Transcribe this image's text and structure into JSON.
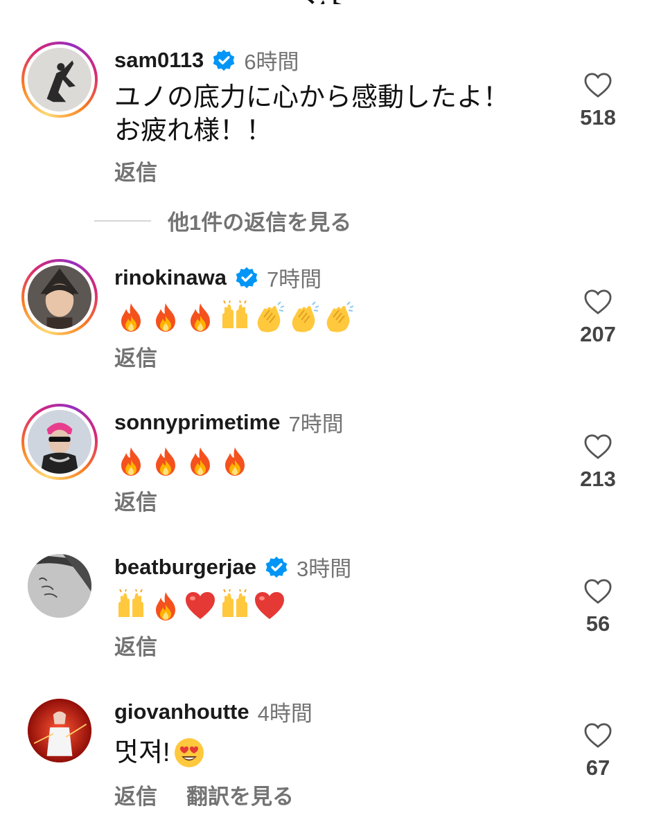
{
  "header": {
    "title_cut": "ント"
  },
  "comments": [
    {
      "username": "sam0113",
      "verified": true,
      "time": "6時間",
      "text_lines": [
        "ユノの底力に心から感動したよ！",
        "お疲れ様！！"
      ],
      "reply_label": "返信",
      "likes": "518",
      "ring": true
    },
    {
      "username": "rinokinawa",
      "verified": true,
      "time": "7時間",
      "emojis": [
        "fire",
        "fire",
        "fire",
        "raised-hands",
        "clap",
        "clap",
        "clap"
      ],
      "reply_label": "返信",
      "likes": "207",
      "ring": true
    },
    {
      "username": "sonnyprimetime",
      "verified": false,
      "time": "7時間",
      "emojis": [
        "fire",
        "fire",
        "fire",
        "fire"
      ],
      "reply_label": "返信",
      "likes": "213",
      "ring": true
    },
    {
      "username": "beatburgerjae",
      "verified": true,
      "time": "3時間",
      "emojis": [
        "raised-hands",
        "fire",
        "red-heart",
        "raised-hands",
        "red-heart"
      ],
      "reply_label": "返信",
      "likes": "56",
      "ring": false
    },
    {
      "username": "giovanhoutte",
      "verified": false,
      "time": "4時間",
      "text_lines": [
        "멋져!"
      ],
      "text_emoji": "heart-eyes",
      "reply_label": "返信",
      "translate_label": "翻訳を見る",
      "likes": "67",
      "ring": false
    }
  ],
  "more_replies": {
    "label": "他1件の返信を見る"
  },
  "colors": {
    "verified": "#0095f6",
    "muted": "#737373",
    "text": "#111111"
  }
}
